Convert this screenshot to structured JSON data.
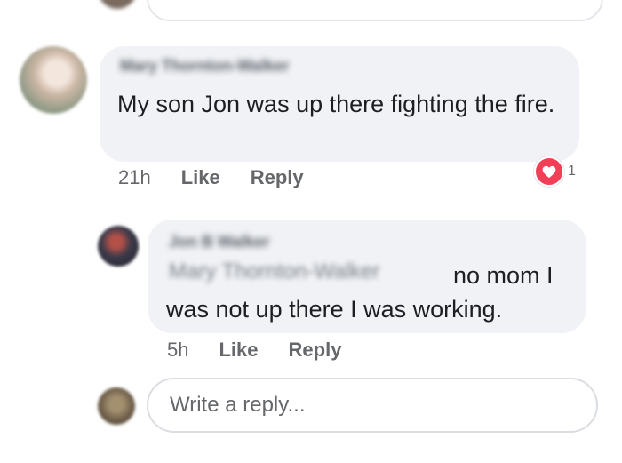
{
  "comments": [
    {
      "author": "Mary Thornton-Walker",
      "text": "My son Jon was up there fighting the fire.",
      "time": "21h",
      "like_label": "Like",
      "reply_label": "Reply",
      "reaction": {
        "icon": "heart-icon",
        "color": "#f33e58",
        "count": "1"
      }
    }
  ],
  "replies": [
    {
      "author": "Jon B Walker",
      "mention": "Mary Thornton-Walker",
      "text_line1": "no mom I",
      "text_line2": "was not up there I was working.",
      "time": "5h",
      "like_label": "Like",
      "reply_label": "Reply"
    }
  ],
  "reply_box": {
    "placeholder": "Write a reply..."
  }
}
